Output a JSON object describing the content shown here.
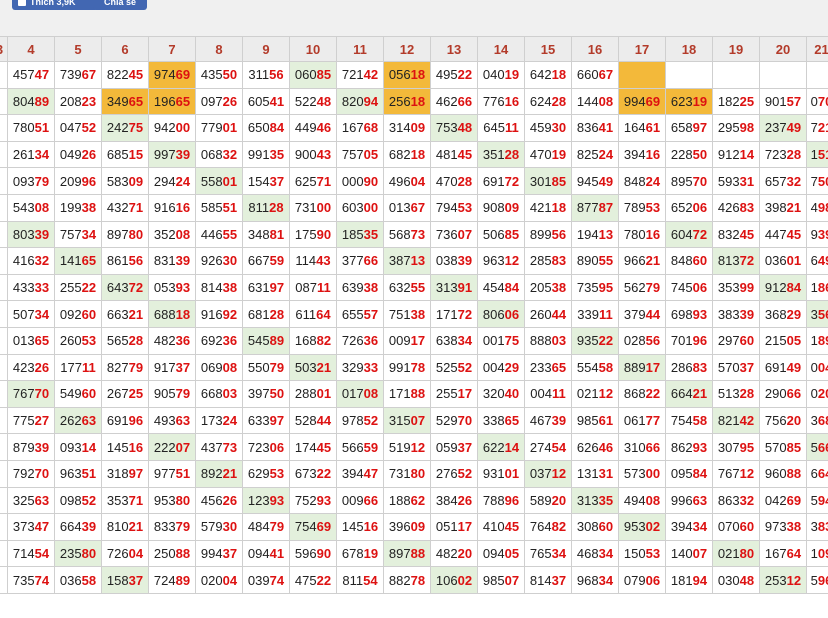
{
  "social": {
    "like_label": "Thích 3,9K",
    "share_label": "Chia sẻ"
  },
  "columns": [
    "3",
    "4",
    "5",
    "6",
    "7",
    "8",
    "9",
    "10",
    "11",
    "12",
    "13",
    "14",
    "15",
    "16",
    "17",
    "18",
    "19",
    "20",
    "21"
  ],
  "rows": [
    [
      {
        "v": ""
      },
      {
        "v": "45747"
      },
      {
        "v": "73967"
      },
      {
        "v": "82245"
      },
      {
        "v": "97469",
        "c": "o"
      },
      {
        "v": "43550"
      },
      {
        "v": "31156"
      },
      {
        "v": "06085",
        "c": "g"
      },
      {
        "v": "72142"
      },
      {
        "v": "05618",
        "c": "o"
      },
      {
        "v": "49522"
      },
      {
        "v": "04019"
      },
      {
        "v": "64218"
      },
      {
        "v": "66067"
      },
      {
        "v": "",
        "c": "o"
      },
      {
        "v": ""
      },
      {
        "v": ""
      },
      {
        "v": ""
      },
      {
        "v": ""
      }
    ],
    [
      {
        "v": ""
      },
      {
        "v": "80489",
        "c": "g"
      },
      {
        "v": "20823"
      },
      {
        "v": "34965",
        "c": "o"
      },
      {
        "v": "19665",
        "c": "o"
      },
      {
        "v": "09726"
      },
      {
        "v": "60541"
      },
      {
        "v": "52248"
      },
      {
        "v": "82094",
        "c": "g"
      },
      {
        "v": "25618",
        "c": "o"
      },
      {
        "v": "46266"
      },
      {
        "v": "77616"
      },
      {
        "v": "62428"
      },
      {
        "v": "14408"
      },
      {
        "v": "99469",
        "c": "o"
      },
      {
        "v": "62319",
        "c": "o"
      },
      {
        "v": "18225"
      },
      {
        "v": "90157"
      },
      {
        "v": "070"
      }
    ],
    [
      {
        "v": ""
      },
      {
        "v": "78051"
      },
      {
        "v": "04752"
      },
      {
        "v": "24275",
        "c": "g"
      },
      {
        "v": "94200"
      },
      {
        "v": "77901"
      },
      {
        "v": "65084"
      },
      {
        "v": "44946"
      },
      {
        "v": "16768"
      },
      {
        "v": "31409"
      },
      {
        "v": "75348",
        "c": "g"
      },
      {
        "v": "64511"
      },
      {
        "v": "45930"
      },
      {
        "v": "83641"
      },
      {
        "v": "16461"
      },
      {
        "v": "65897"
      },
      {
        "v": "29598"
      },
      {
        "v": "23749",
        "c": "g"
      },
      {
        "v": "721"
      }
    ],
    [
      {
        "v": ""
      },
      {
        "v": "26134"
      },
      {
        "v": "04926"
      },
      {
        "v": "68515"
      },
      {
        "v": "99739",
        "c": "g"
      },
      {
        "v": "06832"
      },
      {
        "v": "99135"
      },
      {
        "v": "90043"
      },
      {
        "v": "75705"
      },
      {
        "v": "68218"
      },
      {
        "v": "48145"
      },
      {
        "v": "35128",
        "c": "g"
      },
      {
        "v": "47019"
      },
      {
        "v": "82524"
      },
      {
        "v": "39416"
      },
      {
        "v": "22850"
      },
      {
        "v": "91214"
      },
      {
        "v": "72328"
      },
      {
        "v": "151",
        "c": "g"
      }
    ],
    [
      {
        "v": ""
      },
      {
        "v": "09379"
      },
      {
        "v": "20996"
      },
      {
        "v": "58309"
      },
      {
        "v": "29424"
      },
      {
        "v": "55801",
        "c": "g"
      },
      {
        "v": "15437"
      },
      {
        "v": "62571"
      },
      {
        "v": "00090"
      },
      {
        "v": "49604"
      },
      {
        "v": "47028"
      },
      {
        "v": "69172"
      },
      {
        "v": "30185",
        "c": "g"
      },
      {
        "v": "94549"
      },
      {
        "v": "84824"
      },
      {
        "v": "89570"
      },
      {
        "v": "59331"
      },
      {
        "v": "65732"
      },
      {
        "v": "750"
      }
    ],
    [
      {
        "v": ""
      },
      {
        "v": "54308"
      },
      {
        "v": "19938"
      },
      {
        "v": "43271"
      },
      {
        "v": "91616"
      },
      {
        "v": "58551"
      },
      {
        "v": "81128",
        "c": "g"
      },
      {
        "v": "73100"
      },
      {
        "v": "60300"
      },
      {
        "v": "01367"
      },
      {
        "v": "79453"
      },
      {
        "v": "90809"
      },
      {
        "v": "42118"
      },
      {
        "v": "87787",
        "c": "g"
      },
      {
        "v": "78953"
      },
      {
        "v": "65206"
      },
      {
        "v": "42683"
      },
      {
        "v": "39821"
      },
      {
        "v": "498"
      }
    ],
    [
      {
        "v": ""
      },
      {
        "v": "80339",
        "c": "g"
      },
      {
        "v": "75734"
      },
      {
        "v": "89780"
      },
      {
        "v": "35208"
      },
      {
        "v": "44655"
      },
      {
        "v": "34881"
      },
      {
        "v": "17590"
      },
      {
        "v": "18535",
        "c": "g"
      },
      {
        "v": "56873"
      },
      {
        "v": "73607"
      },
      {
        "v": "50685"
      },
      {
        "v": "89956"
      },
      {
        "v": "19413"
      },
      {
        "v": "78016"
      },
      {
        "v": "60472",
        "c": "g"
      },
      {
        "v": "83245"
      },
      {
        "v": "44745"
      },
      {
        "v": "939"
      }
    ],
    [
      {
        "v": ""
      },
      {
        "v": "41632"
      },
      {
        "v": "14165",
        "c": "g"
      },
      {
        "v": "86156"
      },
      {
        "v": "83139"
      },
      {
        "v": "92630"
      },
      {
        "v": "66759"
      },
      {
        "v": "11443"
      },
      {
        "v": "37766"
      },
      {
        "v": "38713",
        "c": "g"
      },
      {
        "v": "03839"
      },
      {
        "v": "96312"
      },
      {
        "v": "28583"
      },
      {
        "v": "89055"
      },
      {
        "v": "96621"
      },
      {
        "v": "84860"
      },
      {
        "v": "81372",
        "c": "g"
      },
      {
        "v": "03601"
      },
      {
        "v": "649"
      }
    ],
    [
      {
        "v": ""
      },
      {
        "v": "43333"
      },
      {
        "v": "25522"
      },
      {
        "v": "64372",
        "c": "g"
      },
      {
        "v": "05393"
      },
      {
        "v": "81438"
      },
      {
        "v": "63197"
      },
      {
        "v": "08711"
      },
      {
        "v": "63938"
      },
      {
        "v": "63255"
      },
      {
        "v": "31391",
        "c": "g"
      },
      {
        "v": "45484"
      },
      {
        "v": "20538"
      },
      {
        "v": "73595"
      },
      {
        "v": "56279"
      },
      {
        "v": "74506"
      },
      {
        "v": "35399"
      },
      {
        "v": "91284",
        "c": "g"
      },
      {
        "v": "186"
      }
    ],
    [
      {
        "v": ""
      },
      {
        "v": "50734"
      },
      {
        "v": "09260"
      },
      {
        "v": "66321"
      },
      {
        "v": "68818",
        "c": "g"
      },
      {
        "v": "91692"
      },
      {
        "v": "68128"
      },
      {
        "v": "61164"
      },
      {
        "v": "65557"
      },
      {
        "v": "75138"
      },
      {
        "v": "17172"
      },
      {
        "v": "80606",
        "c": "g"
      },
      {
        "v": "26044"
      },
      {
        "v": "33911"
      },
      {
        "v": "37944"
      },
      {
        "v": "69893"
      },
      {
        "v": "38339"
      },
      {
        "v": "36829"
      },
      {
        "v": "356",
        "c": "g"
      }
    ],
    [
      {
        "v": ""
      },
      {
        "v": "01365"
      },
      {
        "v": "26053"
      },
      {
        "v": "56528"
      },
      {
        "v": "48236"
      },
      {
        "v": "69236"
      },
      {
        "v": "54589",
        "c": "g"
      },
      {
        "v": "16882"
      },
      {
        "v": "72636"
      },
      {
        "v": "00917"
      },
      {
        "v": "63834"
      },
      {
        "v": "00175"
      },
      {
        "v": "88803"
      },
      {
        "v": "93522",
        "c": "g"
      },
      {
        "v": "02856"
      },
      {
        "v": "70196"
      },
      {
        "v": "29760"
      },
      {
        "v": "21505"
      },
      {
        "v": "189"
      }
    ],
    [
      {
        "v": ""
      },
      {
        "v": "42326"
      },
      {
        "v": "17711"
      },
      {
        "v": "82779"
      },
      {
        "v": "91737"
      },
      {
        "v": "06908"
      },
      {
        "v": "55079"
      },
      {
        "v": "50321",
        "c": "g"
      },
      {
        "v": "32933"
      },
      {
        "v": "99178"
      },
      {
        "v": "52552"
      },
      {
        "v": "00429"
      },
      {
        "v": "23365"
      },
      {
        "v": "55458"
      },
      {
        "v": "88917",
        "c": "g"
      },
      {
        "v": "28683"
      },
      {
        "v": "57037"
      },
      {
        "v": "69149"
      },
      {
        "v": "004"
      }
    ],
    [
      {
        "v": ""
      },
      {
        "v": "76770",
        "c": "g"
      },
      {
        "v": "54960"
      },
      {
        "v": "26725"
      },
      {
        "v": "90579"
      },
      {
        "v": "66803"
      },
      {
        "v": "39750"
      },
      {
        "v": "28801"
      },
      {
        "v": "01708",
        "c": "g"
      },
      {
        "v": "17188"
      },
      {
        "v": "25517"
      },
      {
        "v": "32040"
      },
      {
        "v": "00411"
      },
      {
        "v": "02112"
      },
      {
        "v": "86822"
      },
      {
        "v": "66421",
        "c": "g"
      },
      {
        "v": "51328"
      },
      {
        "v": "29066"
      },
      {
        "v": "020"
      }
    ],
    [
      {
        "v": ""
      },
      {
        "v": "77527"
      },
      {
        "v": "26263",
        "c": "g"
      },
      {
        "v": "69196"
      },
      {
        "v": "49363"
      },
      {
        "v": "17324"
      },
      {
        "v": "63397"
      },
      {
        "v": "52844"
      },
      {
        "v": "97852"
      },
      {
        "v": "31507",
        "c": "g"
      },
      {
        "v": "52970"
      },
      {
        "v": "33865"
      },
      {
        "v": "46739"
      },
      {
        "v": "98561"
      },
      {
        "v": "06177"
      },
      {
        "v": "75458"
      },
      {
        "v": "82142",
        "c": "g"
      },
      {
        "v": "75620"
      },
      {
        "v": "368"
      }
    ],
    [
      {
        "v": ""
      },
      {
        "v": "87939"
      },
      {
        "v": "09314"
      },
      {
        "v": "14516"
      },
      {
        "v": "22207",
        "c": "g"
      },
      {
        "v": "43773"
      },
      {
        "v": "72306"
      },
      {
        "v": "17445"
      },
      {
        "v": "56659"
      },
      {
        "v": "51912"
      },
      {
        "v": "05937"
      },
      {
        "v": "62214",
        "c": "g"
      },
      {
        "v": "27454"
      },
      {
        "v": "62646"
      },
      {
        "v": "31066"
      },
      {
        "v": "86293"
      },
      {
        "v": "30795"
      },
      {
        "v": "57085"
      },
      {
        "v": "566",
        "c": "g"
      }
    ],
    [
      {
        "v": ""
      },
      {
        "v": "79270"
      },
      {
        "v": "96351"
      },
      {
        "v": "31897"
      },
      {
        "v": "97751"
      },
      {
        "v": "89221",
        "c": "g"
      },
      {
        "v": "62953"
      },
      {
        "v": "67322"
      },
      {
        "v": "39447"
      },
      {
        "v": "73180"
      },
      {
        "v": "27652"
      },
      {
        "v": "93101"
      },
      {
        "v": "03712",
        "c": "g"
      },
      {
        "v": "13131"
      },
      {
        "v": "57300"
      },
      {
        "v": "09584"
      },
      {
        "v": "76712"
      },
      {
        "v": "96088"
      },
      {
        "v": "664"
      }
    ],
    [
      {
        "v": ""
      },
      {
        "v": "32563"
      },
      {
        "v": "09852"
      },
      {
        "v": "35371"
      },
      {
        "v": "95380"
      },
      {
        "v": "45626"
      },
      {
        "v": "12393",
        "c": "g"
      },
      {
        "v": "75293"
      },
      {
        "v": "00966"
      },
      {
        "v": "18862"
      },
      {
        "v": "38426"
      },
      {
        "v": "78896"
      },
      {
        "v": "58920"
      },
      {
        "v": "31335",
        "c": "g"
      },
      {
        "v": "49408"
      },
      {
        "v": "99663"
      },
      {
        "v": "86332"
      },
      {
        "v": "04269"
      },
      {
        "v": "594"
      }
    ],
    [
      {
        "v": ""
      },
      {
        "v": "37347"
      },
      {
        "v": "66439"
      },
      {
        "v": "81021"
      },
      {
        "v": "83379"
      },
      {
        "v": "57930"
      },
      {
        "v": "48479"
      },
      {
        "v": "75469",
        "c": "g"
      },
      {
        "v": "14516"
      },
      {
        "v": "39609"
      },
      {
        "v": "05117"
      },
      {
        "v": "41045"
      },
      {
        "v": "76482"
      },
      {
        "v": "30860"
      },
      {
        "v": "95302",
        "c": "g"
      },
      {
        "v": "39434"
      },
      {
        "v": "07060"
      },
      {
        "v": "97338"
      },
      {
        "v": "383"
      }
    ],
    [
      {
        "v": ""
      },
      {
        "v": "71454"
      },
      {
        "v": "23580",
        "c": "g"
      },
      {
        "v": "72604"
      },
      {
        "v": "25088"
      },
      {
        "v": "99437"
      },
      {
        "v": "09441"
      },
      {
        "v": "59690"
      },
      {
        "v": "67819"
      },
      {
        "v": "89788",
        "c": "g"
      },
      {
        "v": "48220"
      },
      {
        "v": "09405"
      },
      {
        "v": "76534"
      },
      {
        "v": "46834"
      },
      {
        "v": "15053"
      },
      {
        "v": "14007"
      },
      {
        "v": "02180",
        "c": "g"
      },
      {
        "v": "16764"
      },
      {
        "v": "109"
      }
    ],
    [
      {
        "v": ""
      },
      {
        "v": "73574"
      },
      {
        "v": "03658"
      },
      {
        "v": "15837",
        "c": "g"
      },
      {
        "v": "72489"
      },
      {
        "v": "02004"
      },
      {
        "v": "03974"
      },
      {
        "v": "47522"
      },
      {
        "v": "81154"
      },
      {
        "v": "88278"
      },
      {
        "v": "10602",
        "c": "g"
      },
      {
        "v": "98507"
      },
      {
        "v": "81437"
      },
      {
        "v": "96834"
      },
      {
        "v": "07906"
      },
      {
        "v": "18194"
      },
      {
        "v": "03048"
      },
      {
        "v": "25312",
        "c": "g"
      },
      {
        "v": "596"
      }
    ]
  ]
}
